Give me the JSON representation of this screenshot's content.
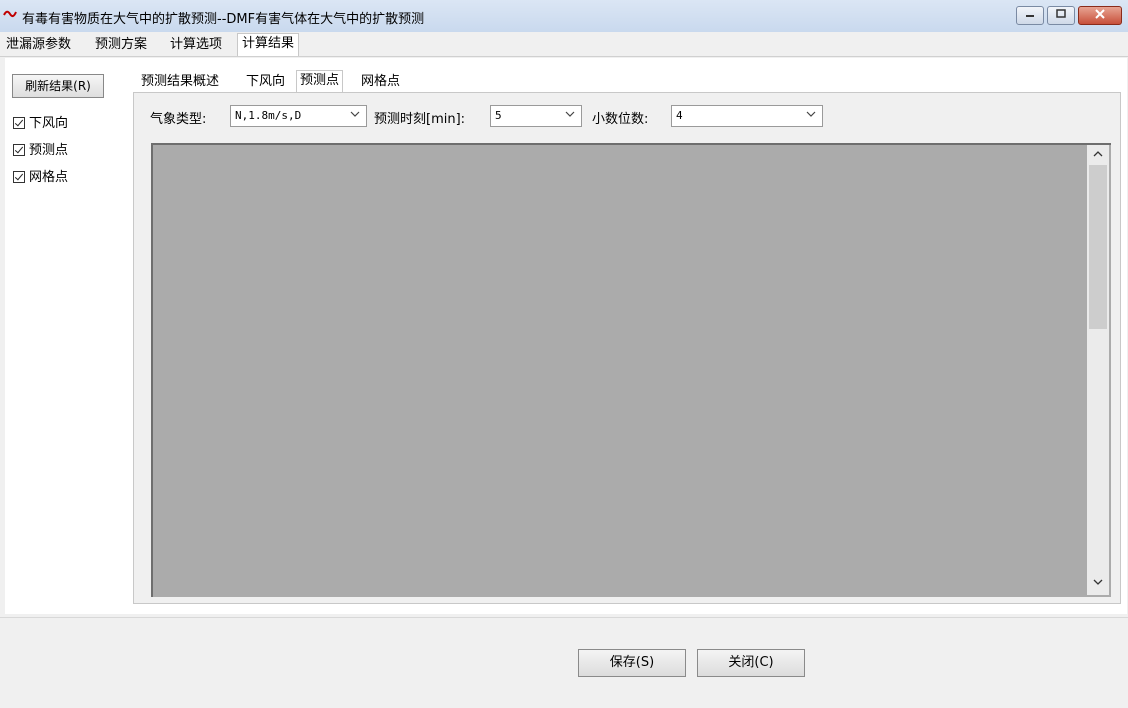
{
  "window": {
    "title": "有毒有害物质在大气中的扩散预测--DMF有害气体在大气中的扩散预测",
    "app_icon": "app-logo-icon",
    "controls": {
      "minimize": "minimize-icon",
      "maximize": "maximize-icon",
      "close": "close-icon"
    }
  },
  "top_tabs": [
    {
      "label": "泄漏源参数",
      "active": false
    },
    {
      "label": "预测方案",
      "active": false
    },
    {
      "label": "计算选项",
      "active": false
    },
    {
      "label": "计算结果",
      "active": true
    }
  ],
  "left_panel": {
    "refresh_label": "刷新结果(R)",
    "checkboxes": [
      {
        "label": "下风向",
        "checked": true
      },
      {
        "label": "预测点",
        "checked": true
      },
      {
        "label": "网格点",
        "checked": true
      }
    ]
  },
  "result_tabs": [
    {
      "label": "预测结果概述",
      "active": false
    },
    {
      "label": "下风向",
      "active": false
    },
    {
      "label": "预测点",
      "active": true
    },
    {
      "label": "网格点",
      "active": false
    }
  ],
  "controls": {
    "weather_label": "气象类型:",
    "weather_value": "N,1.8m/s,D",
    "time_label": "预测时刻[min]:",
    "time_value": "5",
    "decimal_label": "小数位数:",
    "decimal_value": "4"
  },
  "footer": {
    "save_label": "保存(S)",
    "close_label": "关闭(C)"
  },
  "colors": {
    "grid_background": "#ababab",
    "close_button": "#c7503a"
  }
}
